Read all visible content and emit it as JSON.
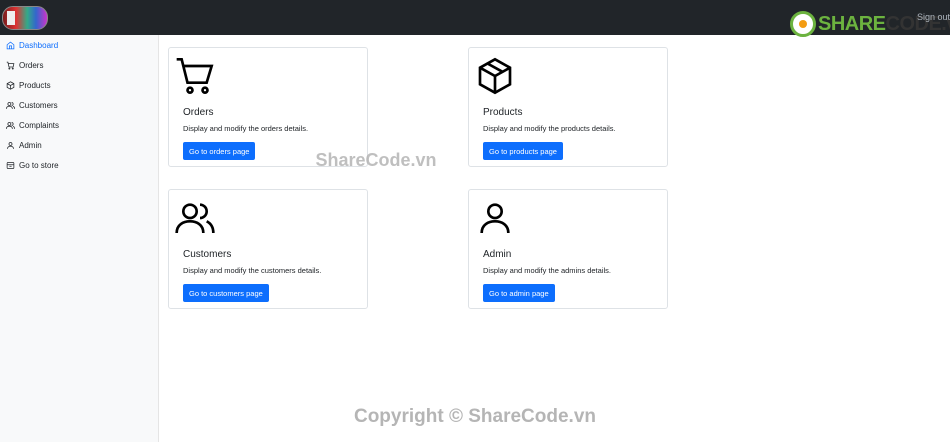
{
  "header": {
    "signout_label": "Sign out",
    "brand_part1": "SHARE",
    "brand_part2": "CODE.vn",
    "dark_color": "#212529"
  },
  "sidebar": {
    "items": [
      {
        "label": "Dashboard",
        "icon": "home-icon",
        "active": true
      },
      {
        "label": "Orders",
        "icon": "cart-icon"
      },
      {
        "label": "Products",
        "icon": "package-icon"
      },
      {
        "label": "Customers",
        "icon": "users-icon"
      },
      {
        "label": "Complaints",
        "icon": "users-icon"
      },
      {
        "label": "Admin",
        "icon": "user-icon"
      },
      {
        "label": "Go to store",
        "icon": "store-icon"
      }
    ]
  },
  "cards": {
    "orders": {
      "title": "Orders",
      "desc": "Display and modify the orders details.",
      "button": "Go to orders page",
      "icon": "cart-icon"
    },
    "products": {
      "title": "Products",
      "desc": "Display and modify the products details.",
      "button": "Go to products page",
      "icon": "package-icon"
    },
    "customers": {
      "title": "Customers",
      "desc": "Display and modify the customers details.",
      "button": "Go to customers page",
      "icon": "users-icon"
    },
    "admin": {
      "title": "Admin",
      "desc": "Display and modify the admins details.",
      "button": "Go to admin page",
      "icon": "user-icon"
    }
  },
  "watermarks": {
    "center": "ShareCode.vn",
    "bottom": "Copyright © ShareCode.vn"
  },
  "colors": {
    "primary": "#0d6efd",
    "topbar": "#212529",
    "brand_green": "#6cb33f"
  }
}
